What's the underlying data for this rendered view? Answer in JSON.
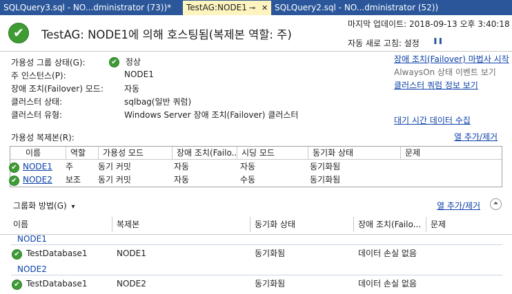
{
  "tabs": [
    {
      "label": "SQLQuery3.sql - NO...dministrator (73))*"
    },
    {
      "label": "TestAG:NODE1",
      "pin_icon": "⊸",
      "close_icon": "✕"
    },
    {
      "label": "SQLQuery2.sql - NO...dministrator (52))"
    }
  ],
  "header": {
    "title": "TestAG: NODE1에 의해 호스팅됨(복제본 역할: 주)",
    "last_update": "마지막 업데이트: 2018-09-13 오후 3:40:18",
    "auto_refresh": "자동 새로 고침: 설정",
    "pause_icon": "❚❚"
  },
  "properties": [
    {
      "label": "가용성 그룹 상태(G):",
      "value": "정상",
      "healthy": true
    },
    {
      "label": "주 인스턴스(P):",
      "value": "NODE1"
    },
    {
      "label": "장애 조치(Failover) 모드:",
      "value": "자동"
    },
    {
      "label": "클러스터 상태:",
      "value": "sqlbag(일반 쿼럼)"
    },
    {
      "label": "클러스터 유형:",
      "value": "Windows Server 장애 조치(Failover) 클러스터"
    }
  ],
  "side_links": {
    "failover_wizard": "장애 조치(Failover) 마법사 시작",
    "alwayson_events": "AlwaysOn 상태 이벤트 보기",
    "cluster_quorum": "클러스터 쿼럼 정보 보기",
    "latency_data": "대기 시간 데이터 수집"
  },
  "replicas": {
    "label": "가용성 복제본(R):",
    "add_remove": "열 추가/제거",
    "columns": [
      "이름",
      "역할",
      "가용성 모드",
      "장애 조치(Failo...",
      "시딩 모드",
      "동기화 상태",
      "문제"
    ],
    "rows": [
      {
        "name": "NODE1",
        "role": "주",
        "availability_mode": "동기 커밋",
        "failover_mode": "자동",
        "seeding_mode": "자동",
        "sync_state": "동기화됨",
        "issues": ""
      },
      {
        "name": "NODE2",
        "role": "보조",
        "availability_mode": "동기 커밋",
        "failover_mode": "자동",
        "seeding_mode": "수동",
        "sync_state": "동기화됨",
        "issues": ""
      }
    ]
  },
  "databases": {
    "group_by": "그룹화 방법(G)",
    "group_by_arrow": "▾",
    "add_remove": "열 추가/제거",
    "collapse_icon": "⏶",
    "columns": [
      "이름",
      "복제본",
      "동기화 상태",
      "장애 조치(Failo...",
      "문제"
    ],
    "groups": [
      {
        "name": "NODE1",
        "rows": [
          {
            "db": "TestDatabase1",
            "replica": "NODE1",
            "sync_state": "동기화됨",
            "failover": "데이터 손실 없음",
            "issues": ""
          }
        ]
      },
      {
        "name": "NODE2",
        "rows": [
          {
            "db": "TestDatabase1",
            "replica": "NODE2",
            "sync_state": "동기화됨",
            "failover": "데이터 손실 없음",
            "issues": ""
          }
        ]
      }
    ]
  },
  "status_icon": "✔",
  "colors": {
    "tabbar": "#2b579a",
    "active_tab": "#fdf4bf",
    "healthy": "#3f9c35",
    "link": "#0b40a8"
  }
}
